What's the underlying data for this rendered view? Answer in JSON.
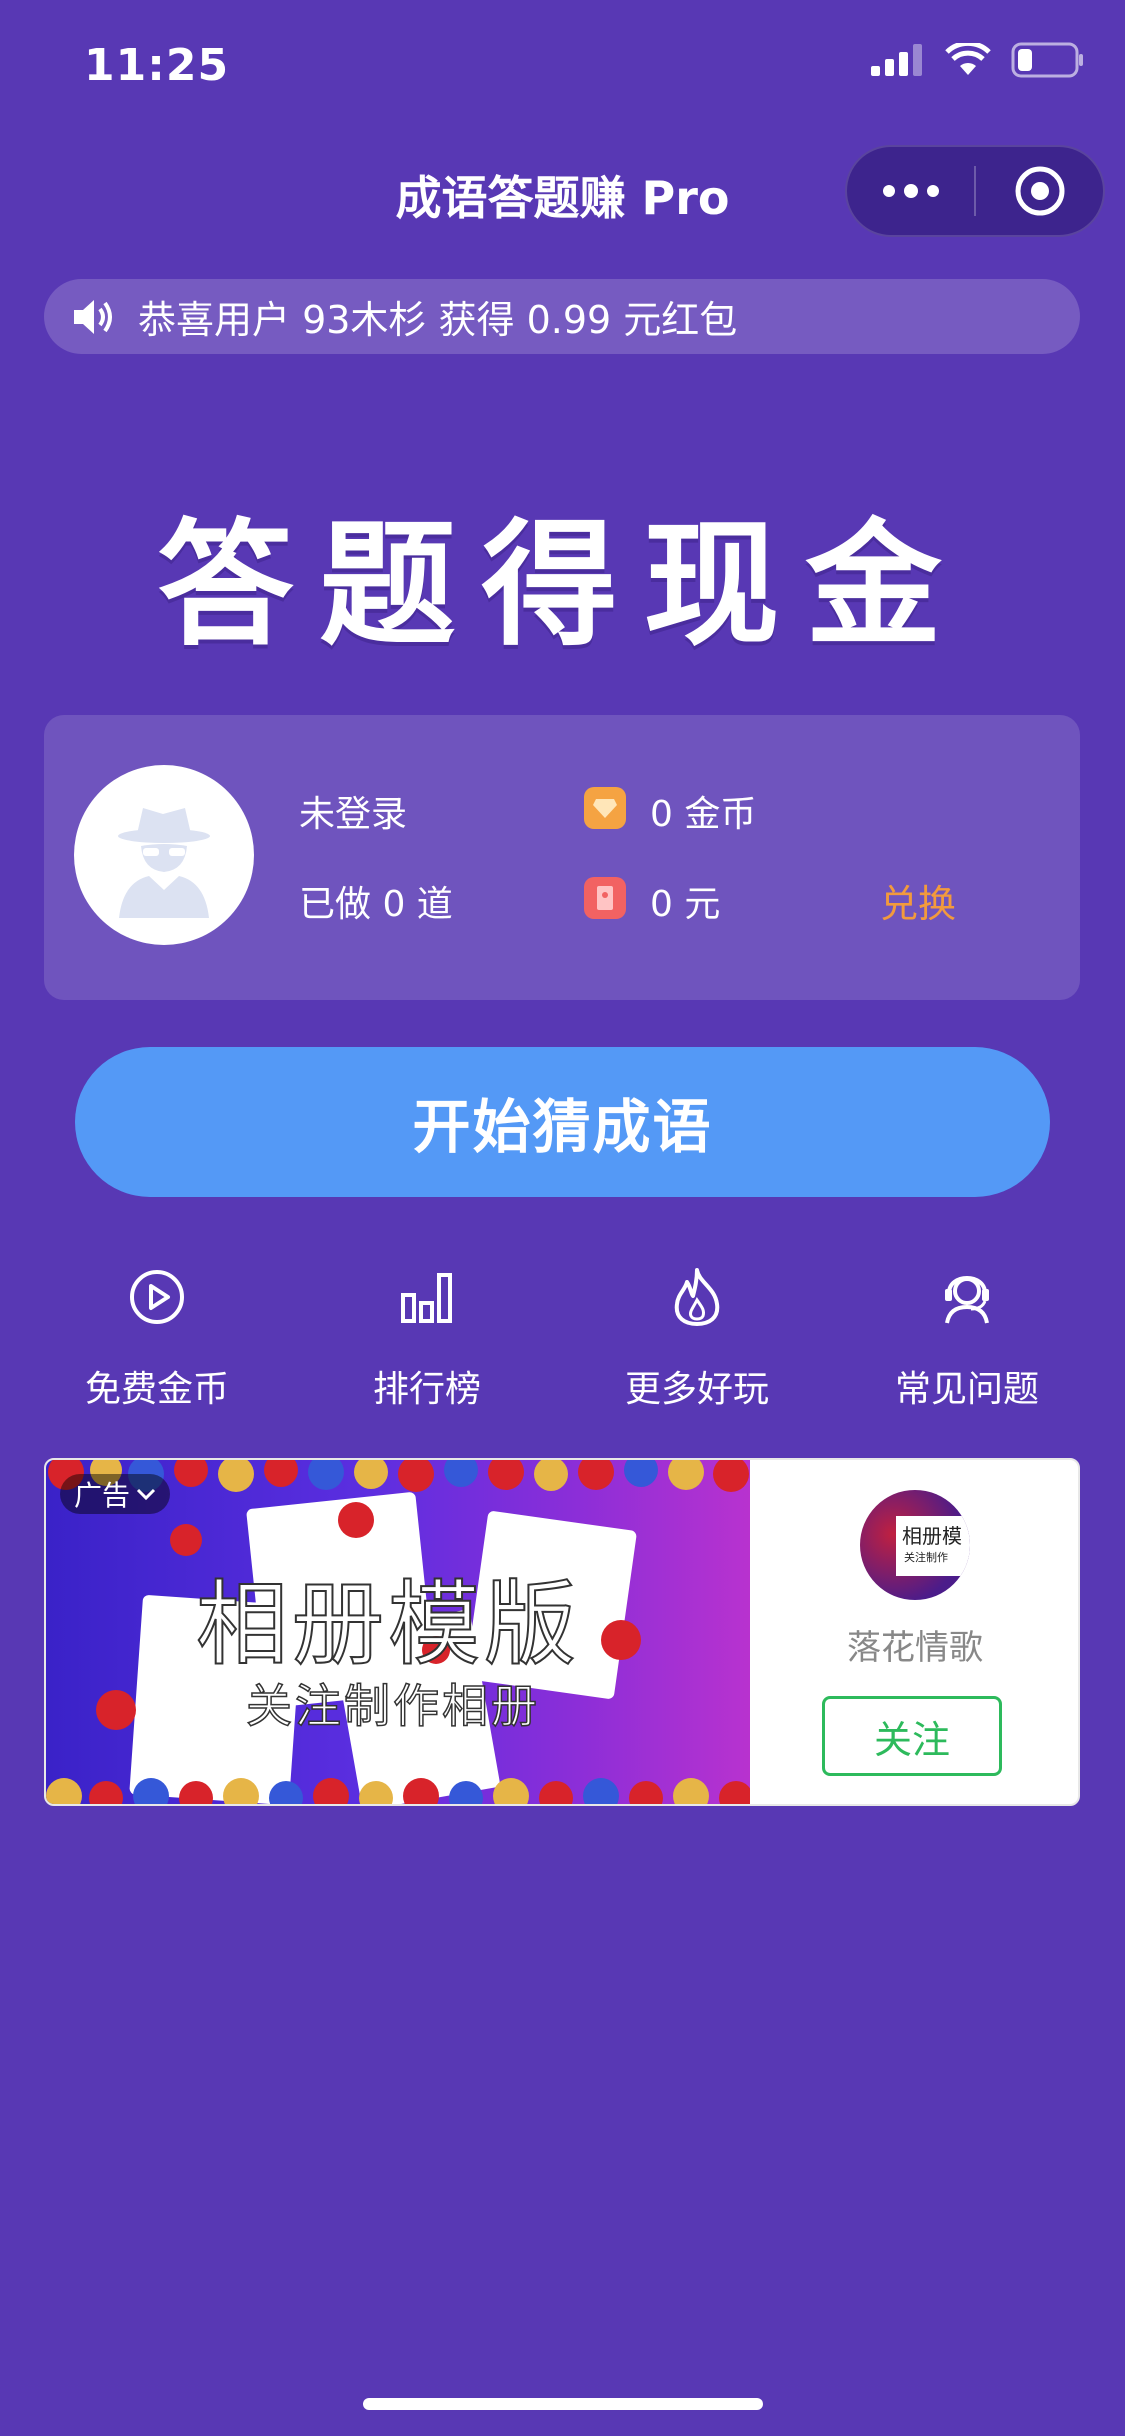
{
  "status_bar": {
    "time": "11:25"
  },
  "nav": {
    "title": "成语答题赚 Pro"
  },
  "notice": {
    "text": "恭喜用户 93木杉 获得 0.99 元红包"
  },
  "headline": "答题得现金",
  "user": {
    "login_status": "未登录",
    "done_text": "已做 0 道",
    "coins_text": "0 金币",
    "cash_text": "0 元",
    "redeem_label": "兑换"
  },
  "start_button": "开始猜成语",
  "menu": [
    {
      "label": "免费金币",
      "icon": "play-circle-icon"
    },
    {
      "label": "排行榜",
      "icon": "bar-chart-icon"
    },
    {
      "label": "更多好玩",
      "icon": "flame-icon"
    },
    {
      "label": "常见问题",
      "icon": "support-agent-icon"
    }
  ],
  "ad": {
    "tag": "广告",
    "image_title": "相册模版",
    "image_subtitle": "关注制作相册",
    "account_name": "落花情歌",
    "avatar_text": "相册模",
    "avatar_subtext": "关注制作",
    "follow_label": "关注"
  },
  "colors": {
    "background": "#5838B4",
    "start_button": "#5499F6",
    "redeem": "#F29A3D",
    "follow": "#2DBA5C"
  }
}
